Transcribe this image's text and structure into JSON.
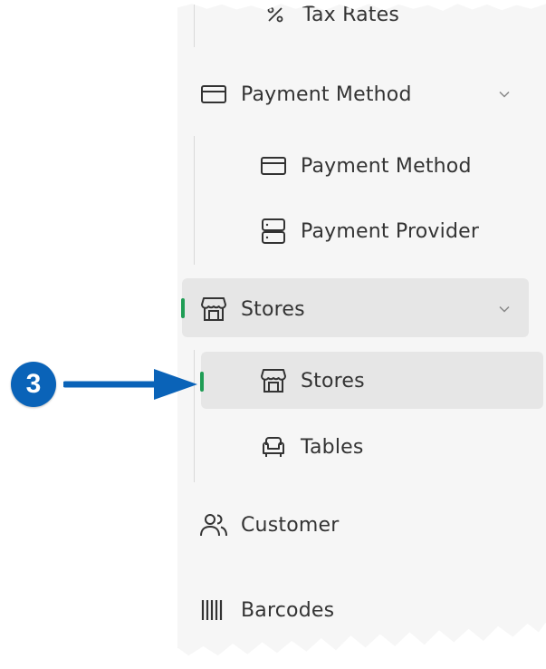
{
  "sidebar": {
    "tax_rates": {
      "label": "Tax Rates",
      "icon": "percent-icon"
    },
    "payment_method_group": {
      "label": "Payment Method",
      "icon": "credit-card-icon",
      "expanded": true
    },
    "payment_method_item": {
      "label": "Payment Method",
      "icon": "credit-card-icon"
    },
    "payment_provider_item": {
      "label": "Payment Provider",
      "icon": "server-icon"
    },
    "stores_group": {
      "label": "Stores",
      "icon": "storefront-icon",
      "expanded": true,
      "active": true
    },
    "stores_item": {
      "label": "Stores",
      "icon": "storefront-icon",
      "selected": true
    },
    "tables_item": {
      "label": "Tables",
      "icon": "armchair-icon"
    },
    "customer": {
      "label": "Customer",
      "icon": "people-icon"
    },
    "barcodes": {
      "label": "Barcodes",
      "icon": "barcode-icon"
    }
  },
  "callout": {
    "number": "3"
  },
  "colors": {
    "accent_bar": "#1f9d55",
    "callout": "#0a63b8",
    "selected_bg": "#e6e6e6",
    "panel_bg": "#f6f6f6"
  }
}
